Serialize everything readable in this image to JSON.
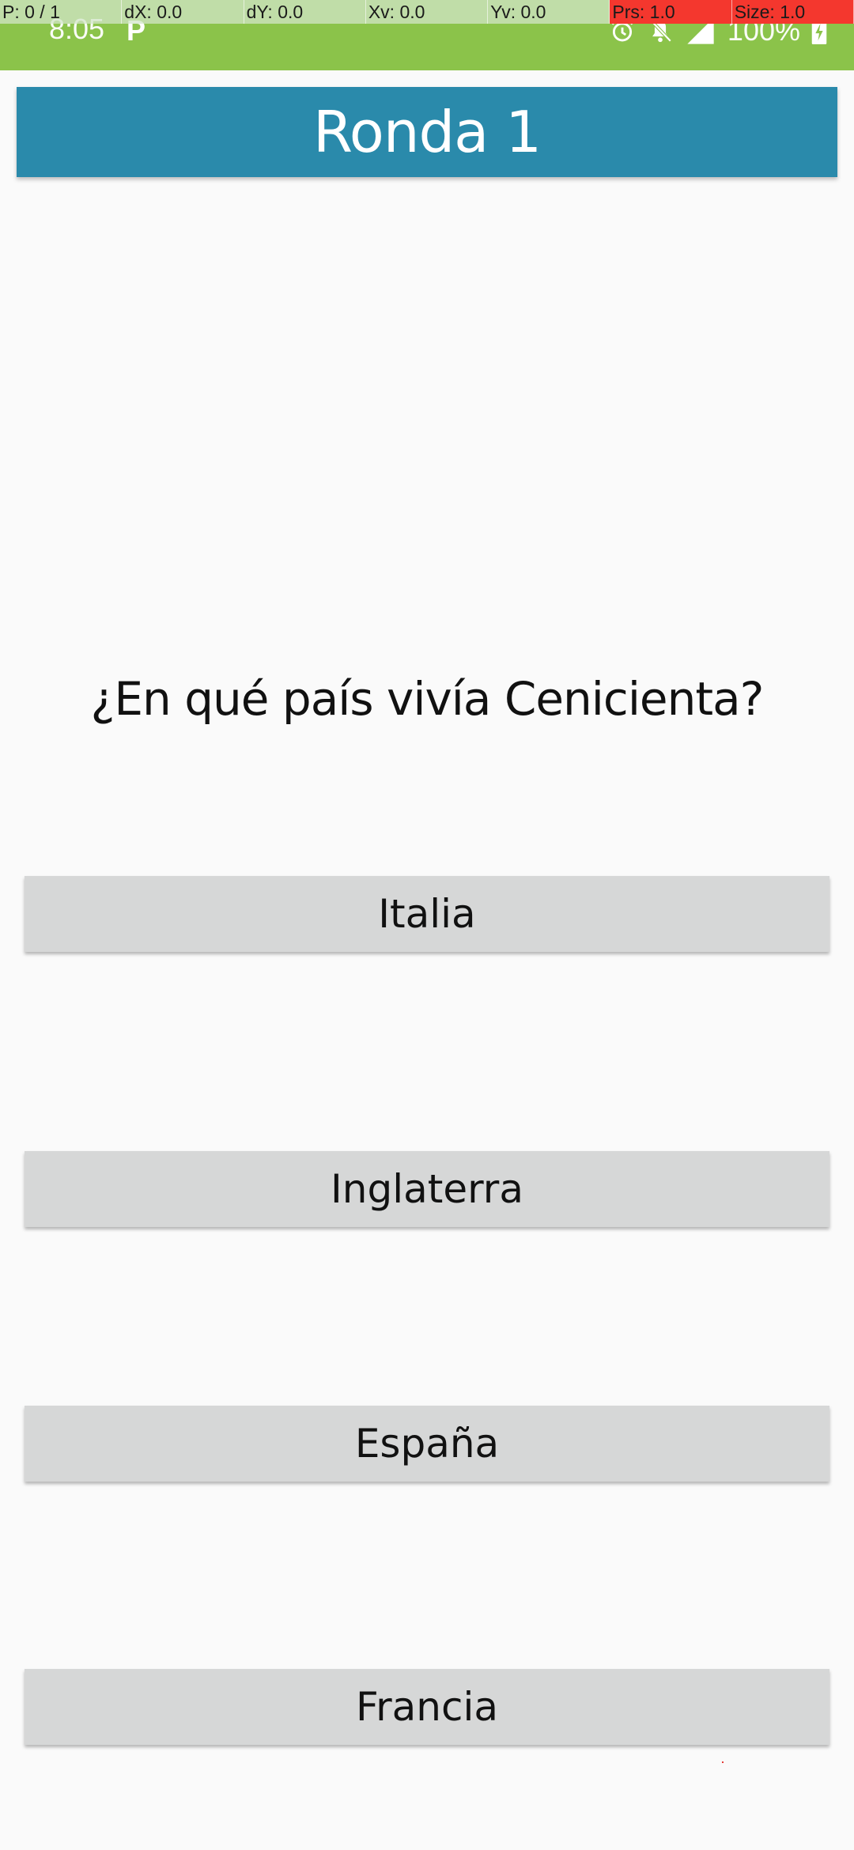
{
  "status_bar": {
    "time": "8:05",
    "notification_icon": "p-icon",
    "battery_percent": "100%",
    "icons": [
      "alarm-icon",
      "bell-off-icon",
      "signal-icon",
      "battery-charging-icon"
    ],
    "color": "#8bc34a"
  },
  "pointer_overlay": {
    "cells": [
      "P: 0 / 1",
      "dX: 0.0",
      "dY: 0.0",
      "Xv: 0.0",
      "Yv: 0.0",
      "Prs: 1.0",
      "Size: 1.0"
    ]
  },
  "header": {
    "title": "Ronda 1",
    "color": "#2a8aab"
  },
  "question": {
    "text": "¿En qué país vivía Cenicienta?"
  },
  "answers": [
    "Italia",
    "Inglaterra",
    "España",
    "Francia"
  ]
}
